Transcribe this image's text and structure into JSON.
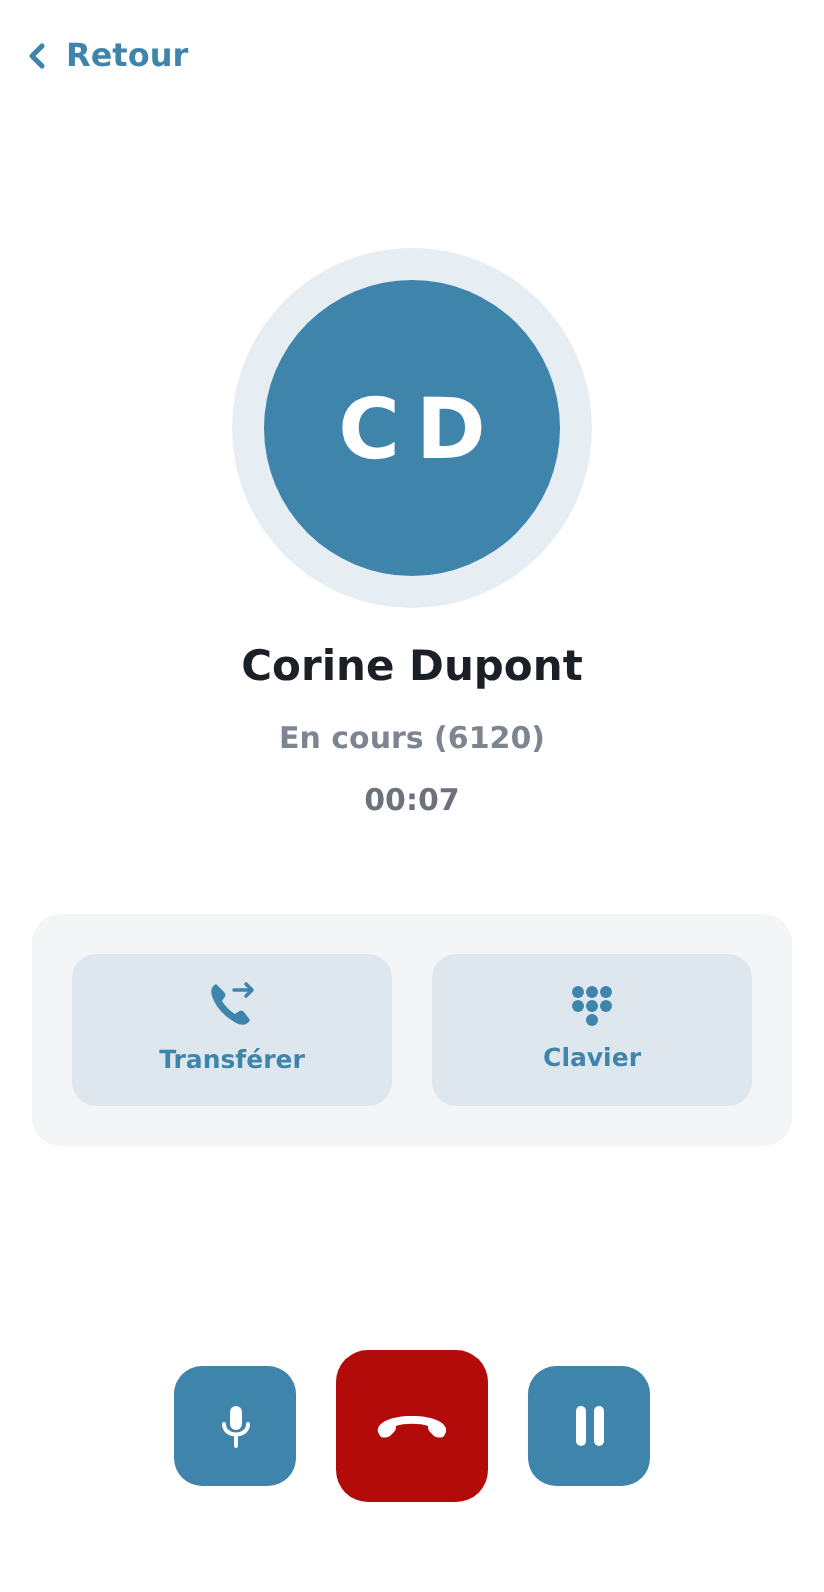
{
  "back": {
    "label": "Retour"
  },
  "caller": {
    "initials": "CD",
    "name": "Corine Dupont",
    "status": "En cours (6120)",
    "timer": "00:07"
  },
  "actions": [
    {
      "kind": "transfer",
      "label": "Transférer"
    },
    {
      "kind": "keypad",
      "label": "Clavier"
    }
  ],
  "controls": [
    {
      "kind": "mute"
    },
    {
      "kind": "hangup"
    },
    {
      "kind": "hold"
    }
  ]
}
